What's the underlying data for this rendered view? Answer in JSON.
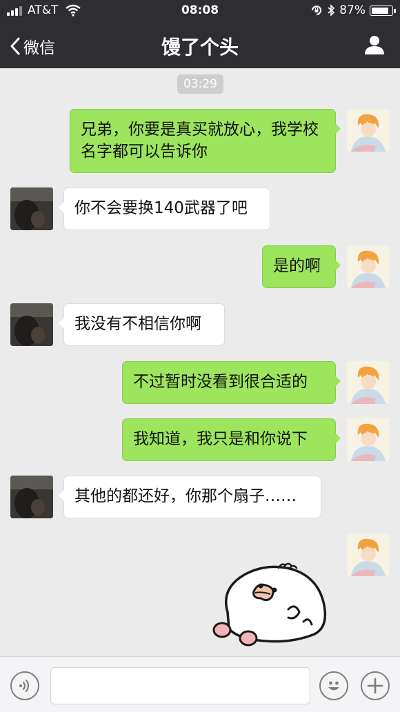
{
  "status_bar": {
    "carrier": "AT&T",
    "time": "08:08",
    "battery": "87%",
    "battery_level": 0.87
  },
  "nav": {
    "back_label": "微信",
    "title": "馒了个头"
  },
  "timestamp": "03:29",
  "messages": [
    {
      "from": "me",
      "text": "兄弟，你要是真买就放心，我学校名字都可以告诉你"
    },
    {
      "from": "other",
      "text": "你不会要换140武器了吧"
    },
    {
      "from": "me",
      "text": "是的啊"
    },
    {
      "from": "other",
      "text": "我没有不相信你啊"
    },
    {
      "from": "me",
      "text": "不过暂时没看到很合适的"
    },
    {
      "from": "me",
      "text": "我知道，我只是和你说下"
    },
    {
      "from": "other",
      "text": "其他的都还好，你那个扇子……"
    },
    {
      "from": "me",
      "type": "sticker",
      "sticker": "lying-chick-sticker"
    }
  ],
  "colors": {
    "nav_bg": "#2e2e32",
    "chat_bg": "#ebebeb",
    "outgoing_bubble": "#9ce55c",
    "incoming_bubble": "#ffffff"
  },
  "icons": {
    "back": "chevron-left-icon",
    "profile": "person-icon",
    "voice": "voice-icon",
    "emoji": "smiley-icon",
    "more": "plus-icon"
  }
}
